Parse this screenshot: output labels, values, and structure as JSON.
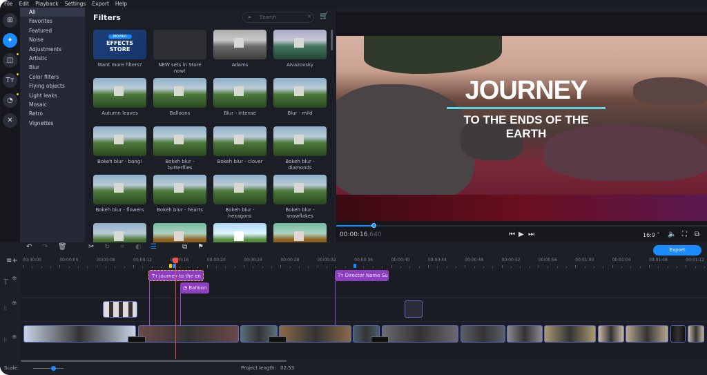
{
  "menu": [
    "File",
    "Edit",
    "Playback",
    "Settings",
    "Export",
    "Help"
  ],
  "rail": [
    {
      "icon": "import-icon",
      "glyph": "⊞"
    },
    {
      "icon": "magic-wand-icon",
      "glyph": "✦",
      "active": true
    },
    {
      "icon": "transitions-icon",
      "glyph": "◫",
      "dot": true
    },
    {
      "icon": "titles-icon",
      "glyph": "Tт",
      "dot": true
    },
    {
      "icon": "stickers-icon",
      "glyph": "◔",
      "dot": true
    },
    {
      "icon": "tools-icon",
      "glyph": "✕"
    }
  ],
  "categories": [
    "All",
    "Favorites",
    "Featured",
    "Noise",
    "Adjustments",
    "Artistic",
    "Blur",
    "Color filters",
    "Flying objects",
    "Light leaks",
    "Mosaic",
    "Retro",
    "Vignettes"
  ],
  "filters": {
    "title": "Filters",
    "search_placeholder": "Search",
    "items": [
      "Want more filters?",
      "NEW sets in Store now!",
      "Adams",
      "Aivazovsky",
      "Autumn leaves",
      "Balloons",
      "Blur - intense",
      "Blur - mild",
      "Bokeh blur - bang!",
      "Bokeh blur - butterflies",
      "Bokeh blur - clover",
      "Bokeh blur - diamonds",
      "Bokeh blur - flowers",
      "Bokeh blur - hearts",
      "Bokeh blur - hexagons",
      "Bokeh blur - snowflakes",
      "",
      "",
      "",
      ""
    ],
    "store_badge": "MOVAVI",
    "store_text": "EFFECTS STORE"
  },
  "preview": {
    "title_line1": "JOURNEY",
    "title_line2": "TO THE ENDS OF THE EARTH",
    "time_main": "00:00:16",
    "time_frac": ".640",
    "progress_fraction": 0.1,
    "aspect": "16:9 ˅"
  },
  "timeline": {
    "export_label": "Export",
    "ruler": [
      "00:00:00",
      "00:00:04",
      "00:00:08",
      "00:00:12",
      "00:00:16",
      "00:00:20",
      "00:00:24",
      "00:00:28",
      "00:00:32",
      "00:00:36",
      "00:00:40",
      "00:00:44",
      "00:00:48",
      "00:00:52",
      "00:00:56",
      "00:01:00",
      "00:01:04",
      "00:01:08",
      "00:01:12"
    ],
    "titles": [
      "journey to the en",
      "Balloon",
      "Director Name Su"
    ],
    "scale_label": "Scale:",
    "project_length_label": "Project length:",
    "project_length": "02:53"
  },
  "colors": {
    "accent": "#1a8cff",
    "title_clip": "#8e3fbf",
    "playhead": "#e04848"
  }
}
